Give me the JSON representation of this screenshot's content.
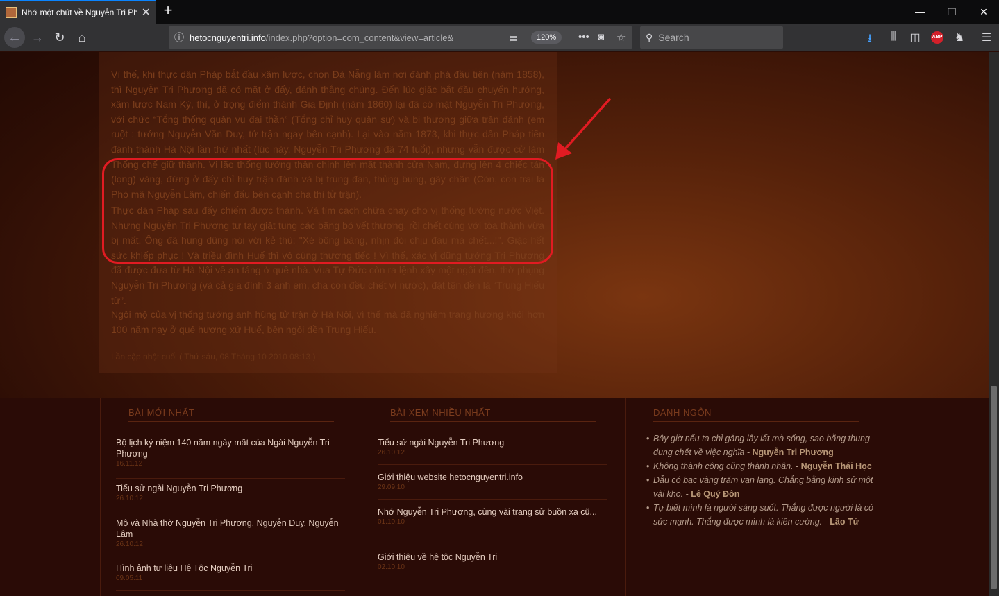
{
  "browser": {
    "tab_title": "Nhớ một chút về Nguyễn Tri Phương",
    "url_host": "hetocnguyentri.info",
    "url_path": "/index.php?option=com_content&view=article&",
    "zoom": "120%",
    "search_placeholder": "Search",
    "abp_label": "ABP"
  },
  "article": {
    "paragraph1": "Vì thế, khi thực dân Pháp bắt đầu xâm lược, chọn Đà Nẵng làm nơi đánh phá đầu tiên (năm 1858), thì Nguyễn Tri Phương đã có mặt ở đấy, đánh thắng chúng. Đến lúc giặc bắt đầu chuyển hướng, xâm lược Nam Kỳ, thì, ở trọng điểm thành Gia Định (năm 1860) lại đã có mặt Nguyễn Tri Phương, với chức “Tổng thống quân vụ đại thần” (Tổng chỉ huy quân sự) và bị thương giữa trận đánh (em ruột : tướng Nguyễn Văn Duy, tử trận ngay bên cạnh). Lại vào năm 1873, khi thực dân Pháp tiến đánh thành Hà Nội lần thứ nhất (lúc này, Nguyễn Tri Phương đã 74 tuổi), nhưng vẫn được cử làm Thống chế giữ thành. Vị lão thống tướng thân chinh lên mặt thành cửa Nam, dựng lên 4 chiếc tán (lọng) vàng, đứng ở đấy chỉ huy trận đánh và bị trúng đạn, thủng bụng, gãy chân (Còn, con trai là Phò mã Nguyễn Lâm, chiến đấu bên cạnh cha thì tử trận).",
    "paragraph2": "Thực dân Pháp sau đấy chiếm được thành. Và tìm cách chữa chạy cho vị thống tướng nước Việt. Nhưng Nguyễn Tri Phương tự tay giật tung các băng bó vết thương, rồi chết cùng với tòa thành vừa bị mất. Ông đã hùng dũng nói với kẻ thù: \"Xé bông băng, nhịn đói chịu đau mà chết...!\". Giặc hết sức khiếp phục ! Và triều đình Huế thì vô cùng thương tiếc ! Vì thế, xác vị dũng tướng Tri Phương đã được đưa từ Hà Nội về an táng ở quê nhà. Vua Tự Đức còn ra lệnh xây một ngôi đền, thờ phụng Nguyễn Tri Phương (và cả gia đình 3 anh em, cha con đều chết vì nước), đặt tên đền là “Trung Hiếu từ”.",
    "paragraph3": "Ngôi mộ của vị thống tướng anh hùng tử trận ở Hà Nội, vì thế mà đã nghiêm trang hương khói hơn 100 năm nay ở quê hương xứ Huế, bên ngôi đền Trung Hiếu.",
    "updated": "Lần cập nhật cuối ( Thứ sáu, 08 Tháng 10 2010 08:13 )"
  },
  "footer": {
    "latest": {
      "heading": "BÀI MỚI NHẤT",
      "items": [
        {
          "title": "Bộ lịch kỷ niệm 140 năm ngày mất của Ngài Nguyễn Tri Phương",
          "date": "16.11.12"
        },
        {
          "title": "Tiểu sử ngài Nguyễn Tri Phương",
          "date": "26.10.12"
        },
        {
          "title": "Mộ và Nhà thờ Nguyễn Tri Phương, Nguyễn Duy, Nguyễn Lâm",
          "date": "26.10.12"
        },
        {
          "title": "Hình ảnh tư liệu Hệ Tộc Nguyễn Tri",
          "date": "09.05.11"
        }
      ]
    },
    "popular": {
      "heading": "BÀI XEM NHIỀU NHẤT",
      "items": [
        {
          "title": "Tiểu sử ngài Nguyễn Tri Phương",
          "date": "26.10.12"
        },
        {
          "title": "Giới thiệu website hetocnguyentri.info",
          "date": "29.09.10"
        },
        {
          "title": "Nhớ Nguyễn Tri Phương, cùng vài trang sử buồn xa cũ...",
          "date": "01.10.10"
        },
        {
          "title": "Giới thiệu về hệ tộc Nguyễn Tri",
          "date": "02.10.10"
        }
      ]
    },
    "quotes": {
      "heading": "DANH NGÔN",
      "items": [
        {
          "text": "Bây giờ nếu ta chỉ gắng lây lất mà sống, sao bằng thung dung chết về việc nghĩa - ",
          "author": "Nguyễn Tri Phương"
        },
        {
          "text": "Không thành công cũng thành nhân. - ",
          "author": "Nguyễn Thái Học"
        },
        {
          "text": "Dẫu có bạc vàng trăm vạn lạng. Chẳng bằng kinh sử một vài kho. - ",
          "author": "Lê Quý Đôn"
        },
        {
          "text": "Tự biết mình là người sáng suốt. Thắng được người là có sức mạnh. Thắng được mình là kiên cường. - ",
          "author": "Lão Tử"
        }
      ]
    }
  },
  "colors": {
    "annotation": "#e11b22",
    "article_text": "#7b3d1b",
    "tab_accent": "#0a84ff"
  }
}
